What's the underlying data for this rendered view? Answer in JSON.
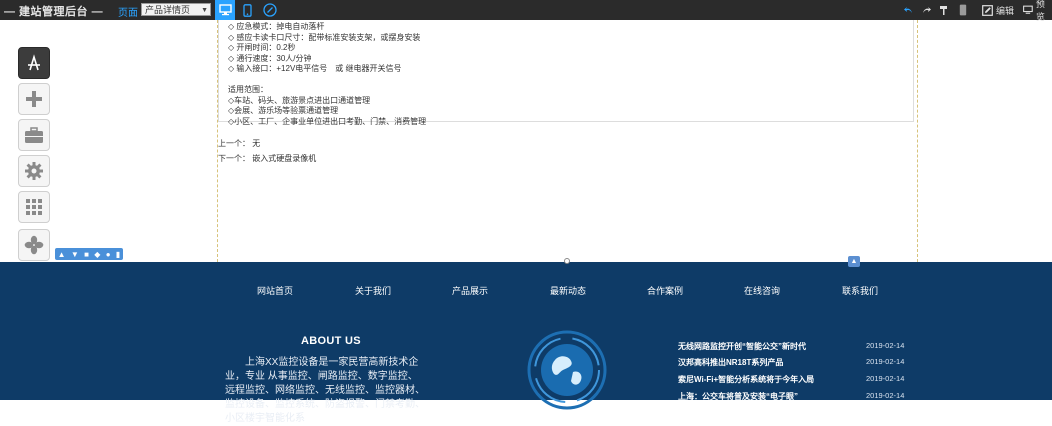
{
  "topbar": {
    "brand": "— 建站管理后台 —",
    "page_label": "页面",
    "page_select": "产品详情页",
    "edit_label": "编辑",
    "preview_label": "预览"
  },
  "spec_lines": [
    "◇ 应急模式：掉电自动落杆",
    "◇ 感应卡读卡口尺寸：配带标准安装支架，或摆身安装",
    "◇ 开闸时间：0.2秒",
    "◇ 通行速度：30人/分钟",
    "◇ 输入接口：+12V电平信号　或 继电器开关信号",
    "",
    "适用范围：",
    "◇车站、码头、旅游景点进出口通道管理",
    "◇会展、游乐场等验票通道管理",
    "◇小区、工厂、企事业单位进出口考勤、门禁、消费管理"
  ],
  "pager": {
    "prev": "上一个：  无",
    "next": "下一个：  嵌入式硬盘录像机"
  },
  "footer": {
    "nav": [
      "网站首页",
      "关于我们",
      "产品展示",
      "最新动态",
      "合作案例",
      "在线咨询",
      "联系我们"
    ],
    "about_title": "ABOUT US",
    "about_text": "上海XX监控设备是一家民营高新技术企业，专业 从事监控、闸路监控、数字监控、远程监控、网络监控、无线监控、监控器材、监控设备、监控系统、防盗报警、门禁考勤、小区楼宇智能化系",
    "news": [
      {
        "title": "无线网路监控开创“智能公交”新时代",
        "date": "2019-02-14"
      },
      {
        "title": "汉邦高科推出NR18T系列产品",
        "date": "2019-02-14"
      },
      {
        "title": "索尼Wi-Fi+智能分析系统将于今年入局",
        "date": "2019-02-14"
      },
      {
        "title": "上海：公交车将普及安装“电子眼”",
        "date": "2019-02-14"
      }
    ]
  },
  "colors": {
    "toolbar_bg": "#2b2b2b",
    "accent": "#2aa3ff",
    "footer_bg": "#0e3b67"
  },
  "icons": {
    "rail": [
      "app-store-icon",
      "plus-icon",
      "toolbox-icon",
      "gear-icon",
      "grid-icon",
      "pinwheel-icon",
      "user-icon",
      "wechat-icon"
    ]
  }
}
